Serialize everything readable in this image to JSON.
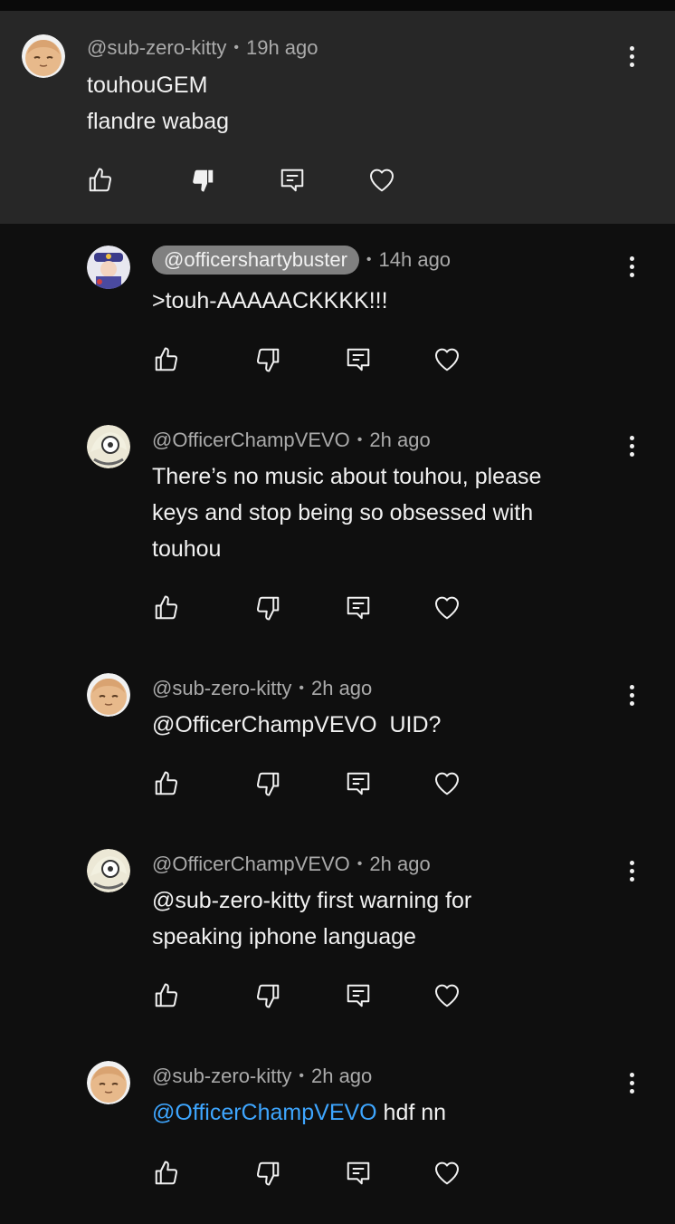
{
  "comments": [
    {
      "handle": "@sub-zero-kitty",
      "time": "19h ago",
      "lines": [
        "touhouGEM",
        "flandre wabag"
      ],
      "avatar": "kitty-avatar",
      "disliked": true
    },
    {
      "handle": "@officershartybuster",
      "time": "14h ago",
      "lines": [
        ">touh-AAAAACKKKK!!!"
      ],
      "avatar": "officer-avatar"
    },
    {
      "handle": "@OfficerChampVEVO",
      "time": "2h ago",
      "lines": [
        "There’s no music about touhou, please",
        "keys and stop being so obsessed with",
        "touhou"
      ],
      "avatar": "champ-avatar"
    },
    {
      "handle": "@sub-zero-kitty",
      "time": "2h ago",
      "lines": [
        "@OfficerChampVEVO  UID?"
      ],
      "avatar": "kitty-avatar"
    },
    {
      "handle": "@OfficerChampVEVO",
      "time": "2h ago",
      "lines": [
        "@sub-zero-kitty first warning for",
        "speaking iphone language"
      ],
      "avatar": "champ-avatar"
    },
    {
      "handle": "@sub-zero-kitty",
      "time": "2h ago",
      "mention": "@OfficerChampVEVO",
      "after_mention": " hdf nn",
      "avatar": "kitty-avatar"
    }
  ],
  "separator": "•",
  "icons": {
    "like": "thumbs-up-icon",
    "dislike": "thumbs-down-icon",
    "reply": "reply-icon",
    "heart": "heart-icon",
    "menu": "more-vertical-icon"
  },
  "colors": {
    "background": "#0f0f0f",
    "highlight": "#272727",
    "mention": "#3ea6ff",
    "meta": "#aaaaaa",
    "text": "#f1f1f1"
  }
}
